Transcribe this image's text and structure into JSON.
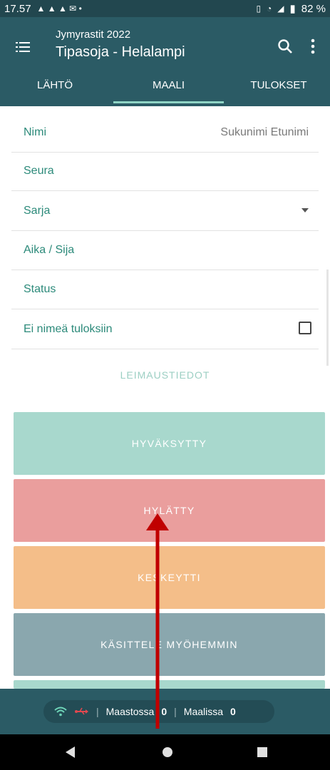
{
  "status_bar": {
    "time": "17.57",
    "battery": "82 %"
  },
  "app_bar": {
    "subtitle": "Jymyrastit 2022",
    "title": "Tipasoja - Helalampi"
  },
  "tabs": [
    {
      "label": "LÄHTÖ"
    },
    {
      "label": "MAALI"
    },
    {
      "label": "TULOKSET"
    }
  ],
  "form": {
    "nimi_label": "Nimi",
    "nimi_placeholder": "Sukunimi Etunimi",
    "seura_label": "Seura",
    "sarja_label": "Sarja",
    "aika_label": "Aika / Sija",
    "status_label": "Status",
    "ei_nimea_label": "Ei nimeä tuloksiin"
  },
  "leimaustiedot_label": "LEIMAUSTIEDOT",
  "status_buttons": [
    {
      "label": "HYVÄKSYTTY",
      "color": "#a8d8cd"
    },
    {
      "label": "HYLÄTTY",
      "color": "#ea9e9d"
    },
    {
      "label": "KESKEYTTI",
      "color": "#f4be89"
    },
    {
      "label": "KÄSITTELE MYÖHEMMIN",
      "color": "#8aa7ae"
    }
  ],
  "bottom": {
    "maastossa_label": "Maastossa",
    "maastossa_count": "0",
    "maalissa_label": "Maalissa",
    "maalissa_count": "0"
  },
  "colors": {
    "appbar": "#2b5b65",
    "accent": "#2c8a7a",
    "annotation_arrow": "#c00000"
  }
}
